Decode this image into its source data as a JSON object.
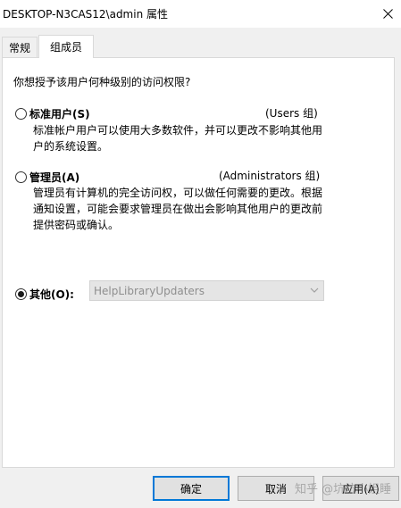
{
  "window": {
    "title": "DESKTOP-N3CAS12\\admin 属性"
  },
  "tabs": [
    {
      "label": "常规"
    },
    {
      "label": "组成员"
    }
  ],
  "content": {
    "prompt": "你想授予该用户何种级别的访问权限?",
    "options": [
      {
        "label": "标准用户(S)",
        "group": "(Users 组)",
        "desc": "标准帐户用户可以使用大多数软件，并可以更改不影响其他用户的系统设置。",
        "checked": false
      },
      {
        "label": "管理员(A)",
        "group": "(Administrators 组)",
        "desc": "管理员有计算机的完全访问权，可以做任何需要的更改。根据通知设置，可能会要求管理员在做出会影响其他用户的更改前提供密码或确认。",
        "checked": false
      },
      {
        "label": "其他(O):",
        "checked": true
      }
    ],
    "other_group_value": "HelpLibraryUpdaters"
  },
  "buttons": {
    "ok": "确定",
    "cancel": "取消",
    "apply": "应用(A)"
  },
  "watermark": "知乎 @坑坑小姐睡",
  "icons": {
    "close": "close-icon",
    "dropdown": "chevron-down-icon"
  }
}
